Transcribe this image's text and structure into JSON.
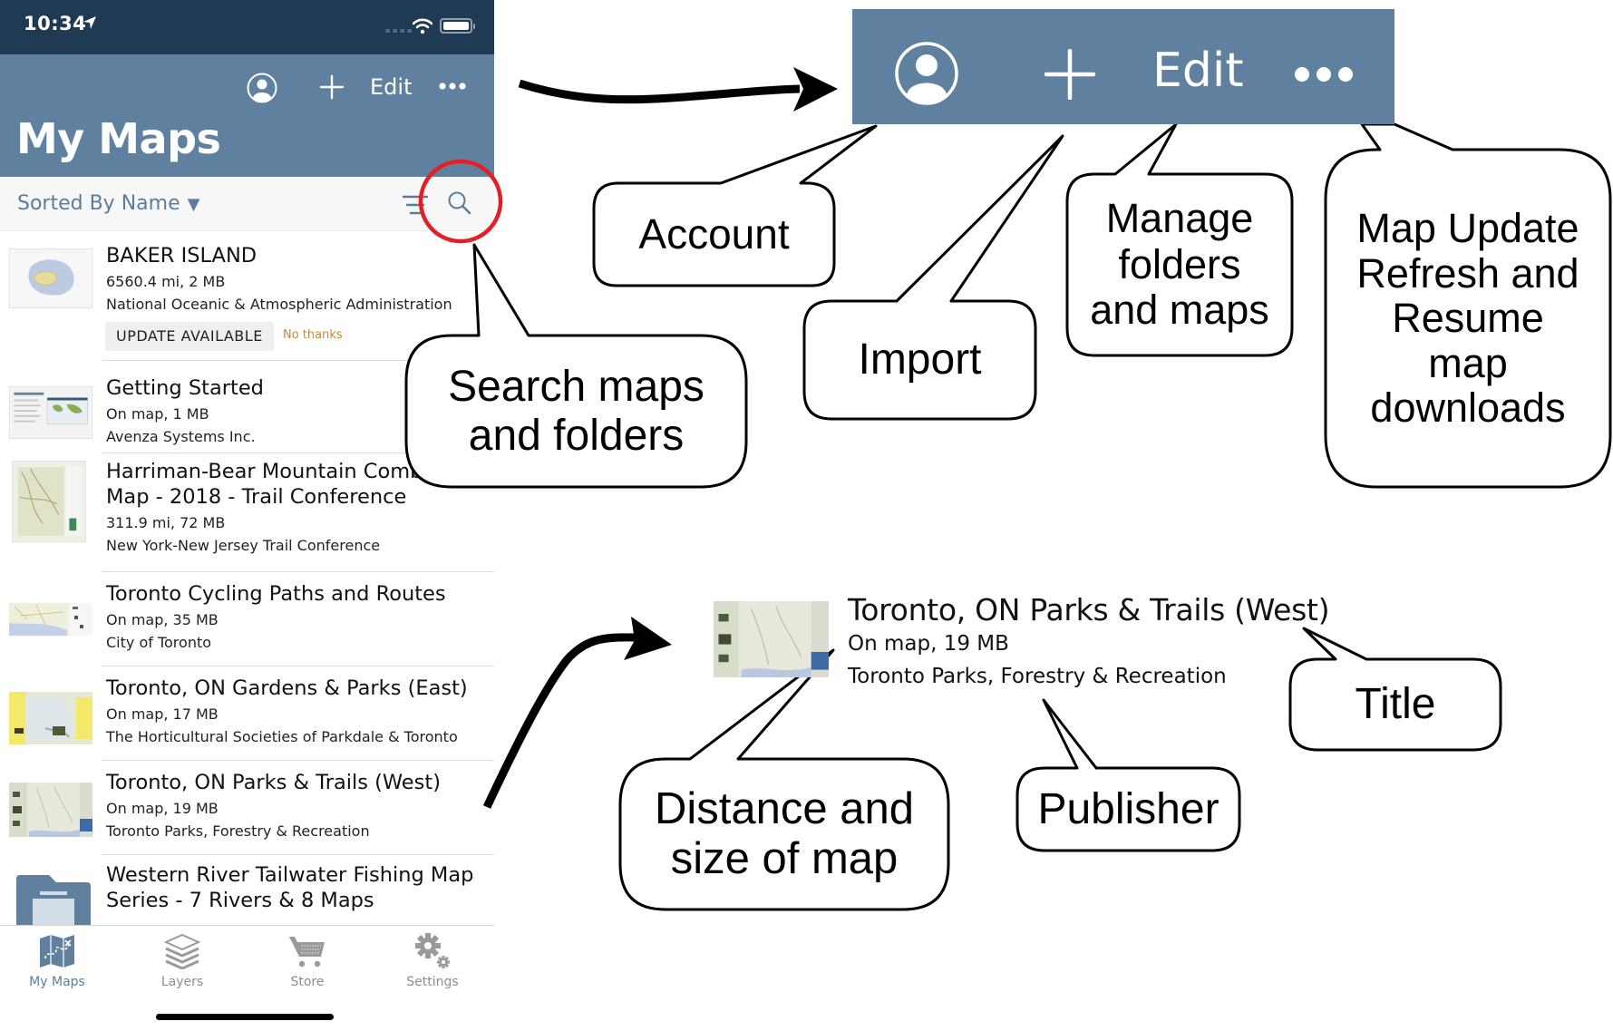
{
  "status_bar": {
    "time": "10:34"
  },
  "nav": {
    "edit_label": "Edit",
    "title": "My Maps",
    "icons": [
      "account-icon",
      "plus-icon",
      "more-icon"
    ]
  },
  "sort_bar": {
    "label": "Sorted By Name",
    "caret": "▼",
    "icons": [
      "filter-icon",
      "search-icon"
    ]
  },
  "maps": [
    {
      "title": "BAKER ISLAND",
      "meta": "6560.4 mi, 2 MB",
      "publisher": "National Oceanic & Atmospheric Administration",
      "update_label": "UPDATE AVAILABLE",
      "dismiss_label": "No thanks"
    },
    {
      "title": "Getting Started",
      "meta": "On map, 1 MB",
      "publisher": "Avenza Systems Inc."
    },
    {
      "title_line1": "Harriman-Bear Mountain Combi",
      "title_line2": "Map - 2018 - Trail Conference",
      "meta": "311.9 mi, 72 MB",
      "publisher": "New York-New Jersey Trail Conference"
    },
    {
      "title": "Toronto Cycling Paths and Routes",
      "meta": "On map, 35 MB",
      "publisher": "City of Toronto"
    },
    {
      "title": "Toronto, ON Gardens & Parks (East)",
      "meta": "On map, 17 MB",
      "publisher": "The Horticultural Societies of Parkdale & Toronto"
    },
    {
      "title": "Toronto, ON Parks & Trails (West)",
      "meta": "On map, 19 MB",
      "publisher": "Toronto Parks, Forestry & Recreation"
    },
    {
      "title_line1": "Western River Tailwater Fishing Map",
      "title_line2": "Series - 7 Rivers & 8 Maps",
      "type": "folder"
    }
  ],
  "tabs": [
    {
      "label": "My Maps",
      "icon": "map-icon",
      "active": true
    },
    {
      "label": "Layers",
      "icon": "layers-icon",
      "active": false
    },
    {
      "label": "Store",
      "icon": "cart-icon",
      "active": false
    },
    {
      "label": "Settings",
      "icon": "gear-icon",
      "active": false
    }
  ],
  "annotations": {
    "toolbar_zoom": {
      "edit_label": "Edit"
    },
    "callouts": {
      "account": "Account",
      "import": "Import",
      "manage": [
        "Manage",
        "folders",
        "and maps"
      ],
      "map_update": [
        "Map Update",
        "Refresh and",
        "Resume",
        "map",
        "downloads"
      ],
      "search": [
        "Search maps",
        "and folders"
      ],
      "title": "Title",
      "distance": [
        "Distance and",
        "size of map"
      ],
      "publisher": "Publisher"
    },
    "enlarged_item": {
      "title": "Toronto, ON Parks & Trails (West)",
      "meta": "On map, 19 MB",
      "publisher": "Toronto Parks, Forestry & Recreation"
    },
    "highlight_color": "#e31e24",
    "toolbar_color": "#5f819f"
  }
}
